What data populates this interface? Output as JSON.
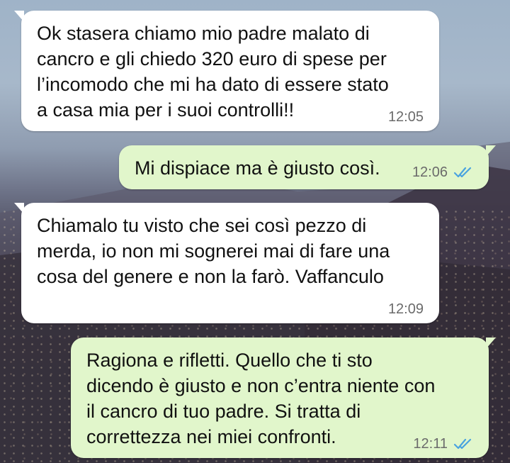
{
  "colors": {
    "incoming_bubble": "#ffffff",
    "outgoing_bubble": "#e1f6cb",
    "timestamp": "#6b6b6b",
    "read_ticks": "#4aa3df"
  },
  "messages": [
    {
      "direction": "incoming",
      "text": "Ok stasera chiamo mio padre malato di\ncancro e gli chiedo 320 euro di spese per\nl’incomodo che mi ha dato di essere stato\na casa mia per i suoi controlli!!",
      "time": "12:05"
    },
    {
      "direction": "outgoing",
      "text": "Mi dispiace ma è giusto così.",
      "time": "12:06",
      "status_icon": "double-check-read-icon"
    },
    {
      "direction": "incoming",
      "text": "Chiamalo tu visto che sei così pezzo di\nmerda, io non mi sognerei mai di fare una\ncosa del genere e non la farò. Vaffanculo",
      "time": "12:09"
    },
    {
      "direction": "outgoing",
      "text": "Ragiona e rifletti. Quello che ti sto\ndicendo è giusto e  non c’entra niente con\nil cancro di tuo padre. Si tratta di\ncorrettezza nei miei confronti.",
      "time": "12:11",
      "status_icon": "double-check-read-icon"
    }
  ]
}
